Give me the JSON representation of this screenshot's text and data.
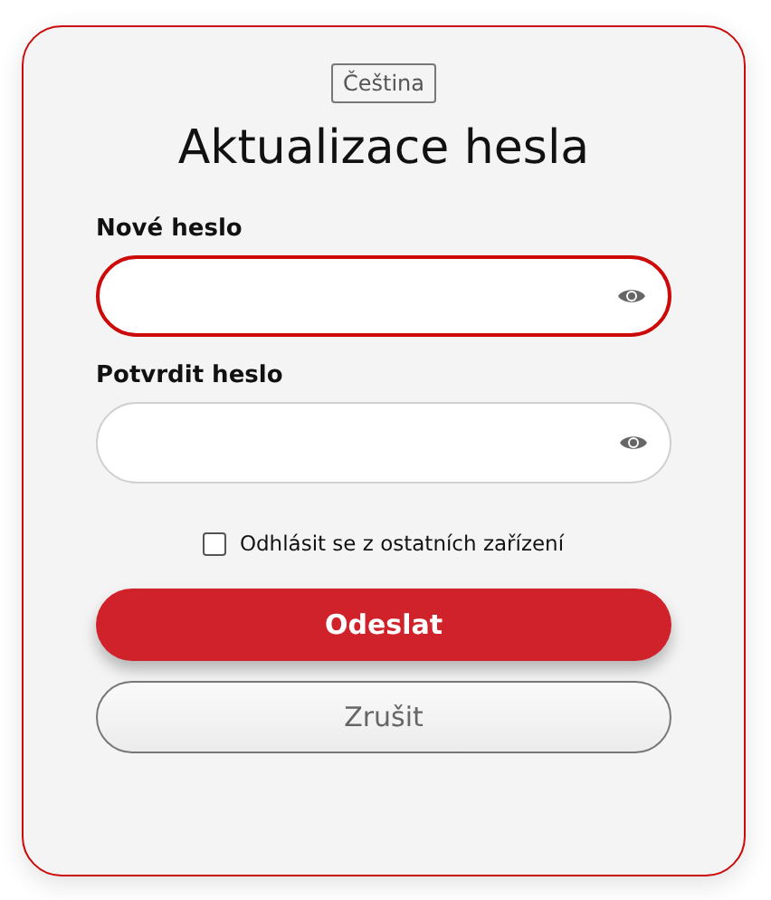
{
  "language_button": "Čeština",
  "title": "Aktualizace hesla",
  "fields": [
    {
      "label": "Nové heslo",
      "focused": true
    },
    {
      "label": "Potvrdit heslo",
      "focused": false
    }
  ],
  "logout_option": {
    "label": "Odhlásit se z ostatních zařízení",
    "checked": false
  },
  "buttons": [
    {
      "label": "Odeslat",
      "kind": "primary"
    },
    {
      "label": "Zrušit",
      "kind": "secondary"
    }
  ]
}
